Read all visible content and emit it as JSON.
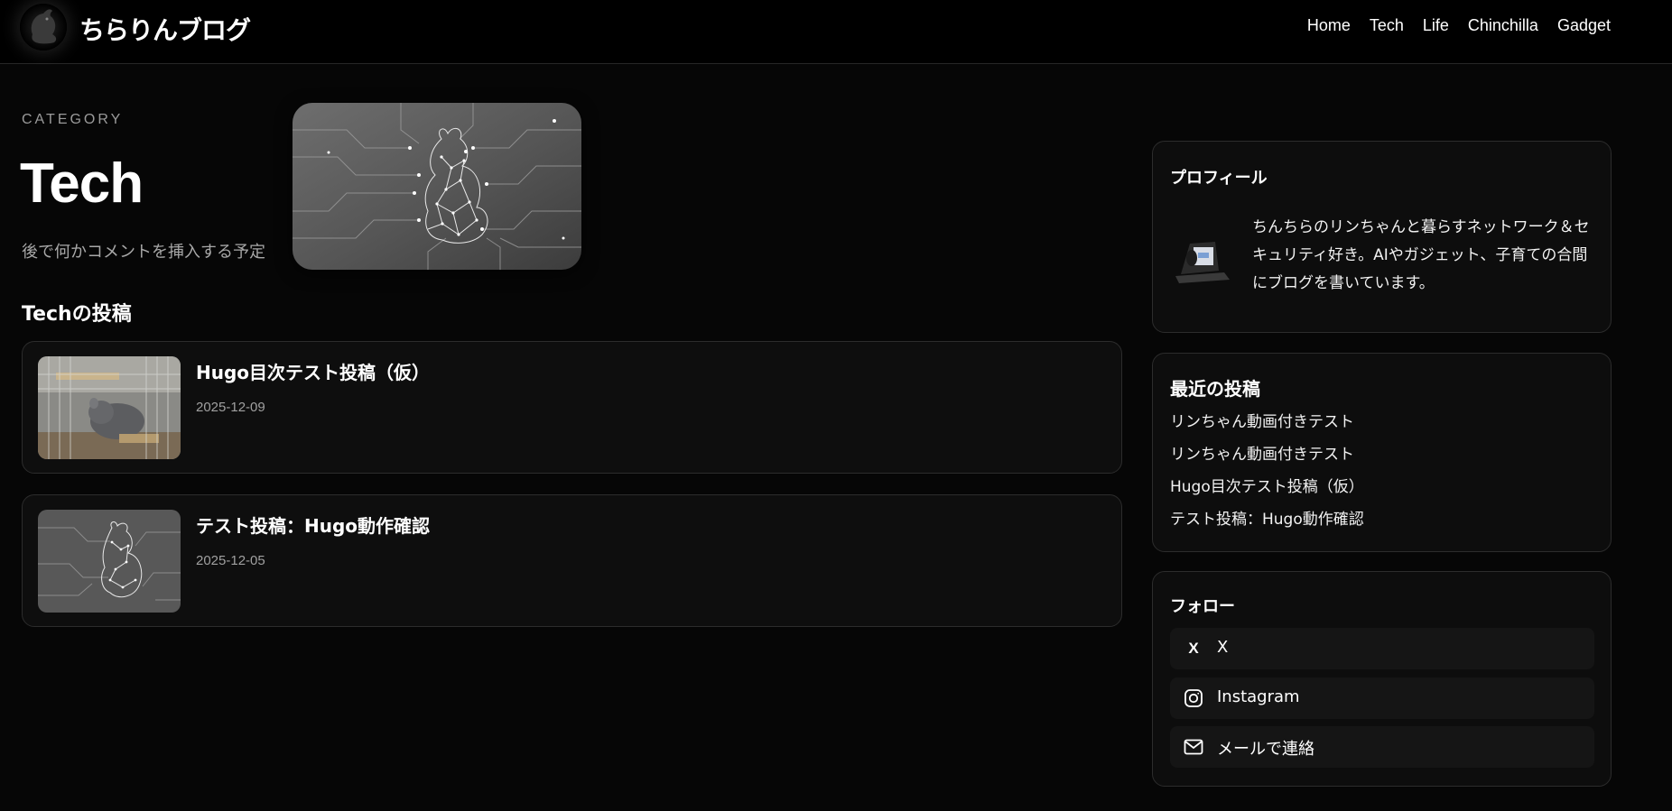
{
  "header": {
    "site_title": "ちらりんブログ",
    "logo_icon": "chinchilla-logo-icon",
    "nav": [
      "Home",
      "Tech",
      "Life",
      "Chinchilla",
      "Gadget"
    ]
  },
  "category": {
    "label": "CATEGORY",
    "title": "Tech",
    "description": "後で何かコメントを挿入する予定",
    "hero_image": "circuit-chinchilla-image"
  },
  "posts_section": {
    "heading": "Techの投稿",
    "posts": [
      {
        "title": "Hugo目次テスト投稿（仮）",
        "date": "2025-12-09",
        "thumbnail": "chinchilla-cage-photo"
      },
      {
        "title": "テスト投稿：Hugo動作確認",
        "date": "2025-12-05",
        "thumbnail": "circuit-chinchilla-image"
      }
    ]
  },
  "sidebar": {
    "profile": {
      "title": "プロフィール",
      "avatar": "laptop-avatar",
      "text": "ちんちらのリンちゃんと暮らすネットワーク＆セキュリティ好き。AIやガジェット、子育ての合間にブログを書いています。"
    },
    "recent": {
      "title": "最近の投稿",
      "items": [
        "リンちゃん動画付きテスト",
        "リンちゃん動画付きテスト",
        "Hugo目次テスト投稿（仮）",
        "テスト投稿：Hugo動作確認"
      ]
    },
    "follow": {
      "title": "フォロー",
      "links": [
        {
          "label": "X",
          "icon": "x-logo-icon",
          "glyph": "X"
        },
        {
          "label": "Instagram",
          "icon": "instagram-icon"
        },
        {
          "label": "メールで連絡",
          "icon": "mail-icon"
        }
      ]
    }
  },
  "colors": {
    "background": "#060606",
    "card_border": "#2c2c2c",
    "text": "#f2f2f2",
    "muted": "#a0a0a0"
  }
}
